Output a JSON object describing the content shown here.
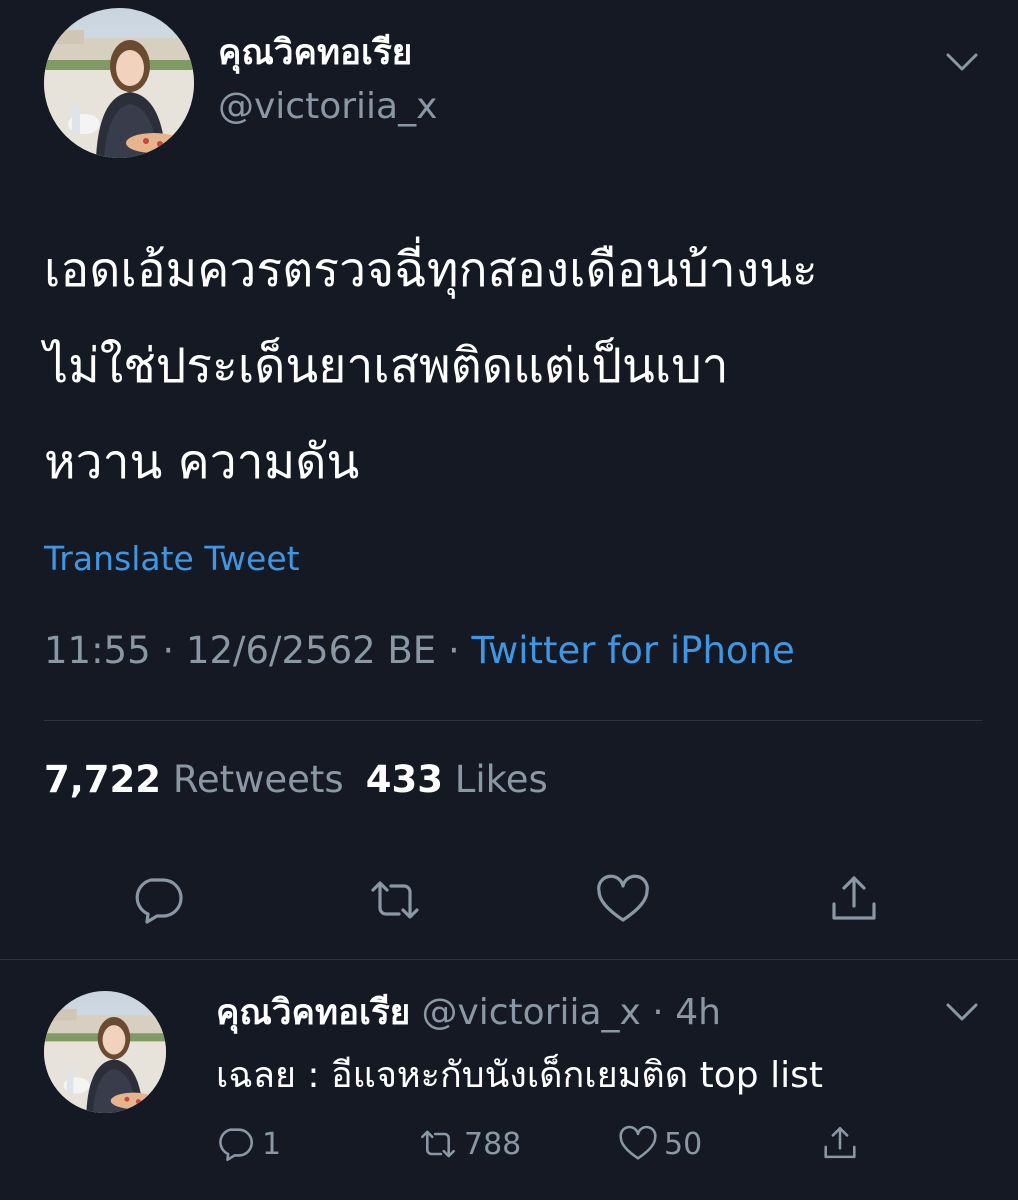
{
  "main_tweet": {
    "display_name": "คุณวิคทอเรีย",
    "handle": "@victoriia_x",
    "text_lines": [
      "เอดเอ้มควรตรวจฉี่ทุกสองเดือนบ้างนะ",
      "ไม่ใช่ประเด็นยาเสพติดแต่เป็นเบา",
      "หวาน ความดัน"
    ],
    "translate_label": "Translate Tweet",
    "time": "11:55",
    "date": "12/6/2562 BE",
    "separator": "·",
    "source": "Twitter for iPhone",
    "retweets_count": "7,722",
    "retweets_label": "Retweets",
    "likes_count": "433",
    "likes_label": "Likes",
    "icons": [
      "avatar",
      "chevron-down-icon",
      "reply-icon",
      "retweet-icon",
      "like-icon",
      "share-icon"
    ]
  },
  "reply_tweet": {
    "display_name": "คุณวิคทอเรีย",
    "handle_time": "@victoriia_x · 4h",
    "text": "เฉลย : อีแจหะกับนังเด็กเยมติด top list",
    "reply_count": "1",
    "retweet_count": "788",
    "like_count": "50",
    "icons": [
      "avatar",
      "chevron-down-icon",
      "reply-icon",
      "retweet-icon",
      "like-icon",
      "share-icon"
    ]
  },
  "colors": {
    "background": "#141923",
    "text": "#ffffff",
    "secondary": "#8a97a4",
    "link": "#3f96e3",
    "divider": "#2c3540"
  }
}
